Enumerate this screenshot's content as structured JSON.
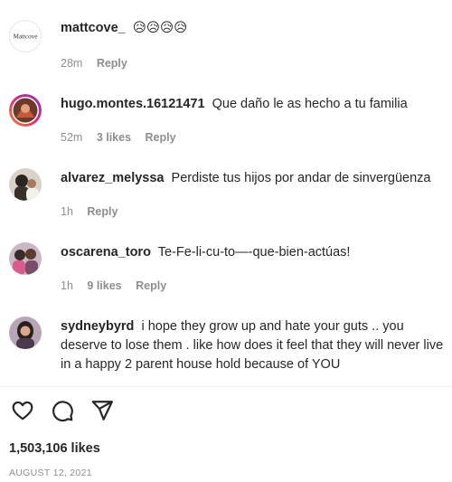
{
  "comments": [
    {
      "username": "mattcove_",
      "text": "😥😥😥😥",
      "avatar_text": "Mattcove",
      "time": "28m",
      "likes": "",
      "reply": "Reply"
    },
    {
      "username": "hugo.montes.16121471",
      "text": "Que daño le as hecho a tu familia",
      "time": "52m",
      "likes": "3 likes",
      "reply": "Reply"
    },
    {
      "username": "alvarez_melyssa",
      "text": "Perdiste tus hijos por andar de sinvergüenza",
      "time": "1h",
      "likes": "",
      "reply": "Reply"
    },
    {
      "username": "oscarena_toro",
      "text": "Te-Fe-li-cu-to—-que-bien-actúas!",
      "time": "1h",
      "likes": "9 likes",
      "reply": "Reply"
    },
    {
      "username": "sydneybyrd",
      "text": "i hope they grow up and hate your guts .. you deserve to lose them . like how does it feel that they will never live in a happy 2 parent house hold because of YOU",
      "time": "",
      "likes": "",
      "reply": ""
    }
  ],
  "actions": {
    "like_icon": "heart-icon",
    "comment_icon": "comment-bubble-icon",
    "share_icon": "paper-plane-icon"
  },
  "post": {
    "likes": "1,503,106 likes",
    "date": "AUGUST 12, 2021"
  },
  "colors": {
    "text": "#262626",
    "secondary": "#8e8e8e",
    "divider": "#efefef"
  }
}
